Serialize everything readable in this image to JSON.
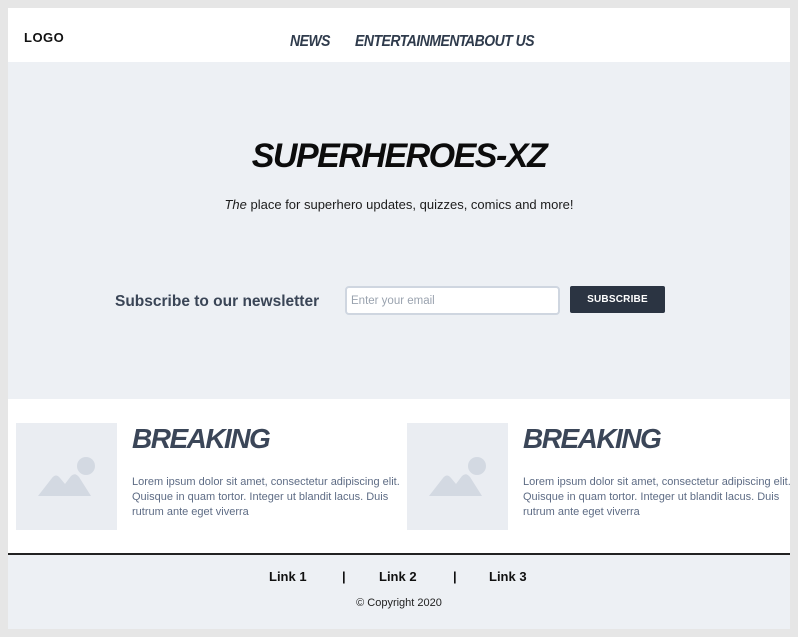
{
  "header": {
    "logo": "LOGO",
    "nav": [
      {
        "label": "NEWS"
      },
      {
        "label": "ENTERTAINMENT"
      },
      {
        "label": "ABOUT US"
      }
    ]
  },
  "hero": {
    "title": "SUPERHEROES-XZ",
    "tagline_em": "The",
    "tagline_rest": " place for superhero updates, quizzes, comics and more!"
  },
  "newsletter": {
    "label": "Subscribe to our newsletter",
    "email_placeholder": "Enter your email",
    "email_value": "",
    "button_label": "SUBSCRIBE"
  },
  "cards": [
    {
      "title": "BREAKING",
      "image_icon": "image-placeholder-icon",
      "body": "Lorem ipsum dolor sit amet, consectetur adipiscing elit. Quisque in quam tortor. Integer ut blandit lacus. Duis rutrum ante eget viverra"
    },
    {
      "title": "BREAKING",
      "image_icon": "image-placeholder-icon",
      "body": "Lorem ipsum dolor sit amet, consectetur adipiscing elit. Quisque in quam tortor. Integer ut blandit lacus. Duis rutrum ante eget viverra"
    }
  ],
  "footer": {
    "links": [
      {
        "label": "Link 1"
      },
      {
        "label": "Link 2"
      },
      {
        "label": "Link 3"
      }
    ],
    "separator": "|",
    "copyright": "© Copyright 2020"
  },
  "colors": {
    "hero_bg": "#edf0f4",
    "button_bg": "#2b3442",
    "nav_text": "#2f3b4c",
    "card_title": "#3b4658",
    "card_body": "#5e6c85"
  }
}
